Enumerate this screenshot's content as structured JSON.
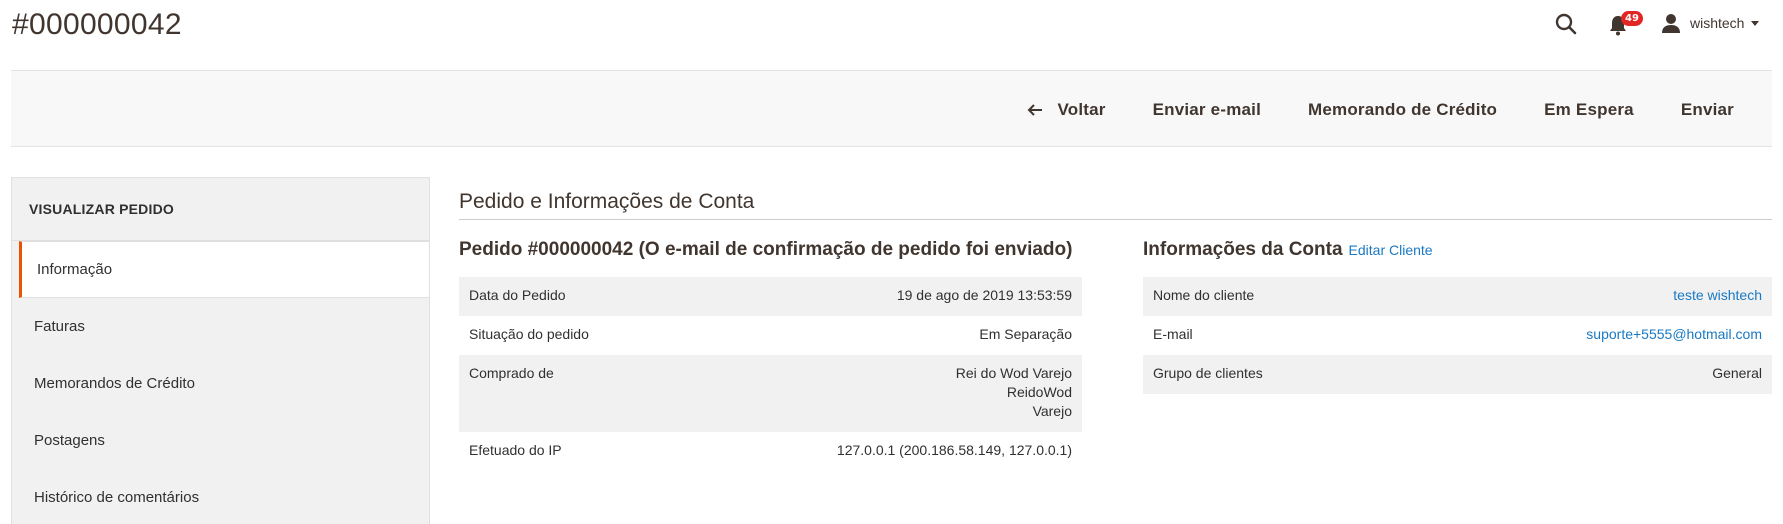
{
  "page": {
    "title": "#000000042"
  },
  "header": {
    "notifications_count": "49",
    "username": "wishtech",
    "icons": {
      "search": "search-icon",
      "notifications": "bell-icon",
      "user": "user-icon",
      "caret": "chevron-down-icon"
    }
  },
  "actions": {
    "back": "Voltar",
    "send_email": "Enviar e-mail",
    "credit_memo": "Memorando de Crédito",
    "hold": "Em Espera",
    "ship": "Enviar"
  },
  "sidebar": {
    "title": "VISUALIZAR PEDIDO",
    "tabs": [
      {
        "label": "Informação"
      },
      {
        "label": "Faturas"
      },
      {
        "label": "Memorandos de Crédito"
      },
      {
        "label": "Postagens"
      },
      {
        "label": "Histórico de comentários"
      }
    ]
  },
  "main": {
    "section_title": "Pedido e Informações de Conta",
    "order": {
      "title": "Pedido #000000042 (O e-mail de confirmação de pedido foi enviado)",
      "rows": [
        {
          "label": "Data do Pedido",
          "value": "19 de ago de 2019 13:53:59"
        },
        {
          "label": "Situação do pedido",
          "value": "Em Separação"
        },
        {
          "label": "Comprado de",
          "value_lines": [
            "Rei do Wod Varejo",
            "ReidoWod",
            "Varejo"
          ]
        },
        {
          "label": "Efetuado do IP",
          "value": "127.0.0.1 (200.186.58.149, 127.0.0.1)"
        }
      ]
    },
    "account": {
      "title": "Informações da Conta",
      "edit_link": "Editar Cliente",
      "rows": [
        {
          "label": "Nome do cliente",
          "value": "teste wishtech"
        },
        {
          "label": "E-mail",
          "value": "suporte+5555@hotmail.com"
        },
        {
          "label": "Grupo de clientes",
          "value": "General"
        }
      ]
    }
  },
  "colors": {
    "accent": "#eb5202",
    "link": "#1979c3",
    "badge": "#e22626",
    "text": "#303030"
  }
}
